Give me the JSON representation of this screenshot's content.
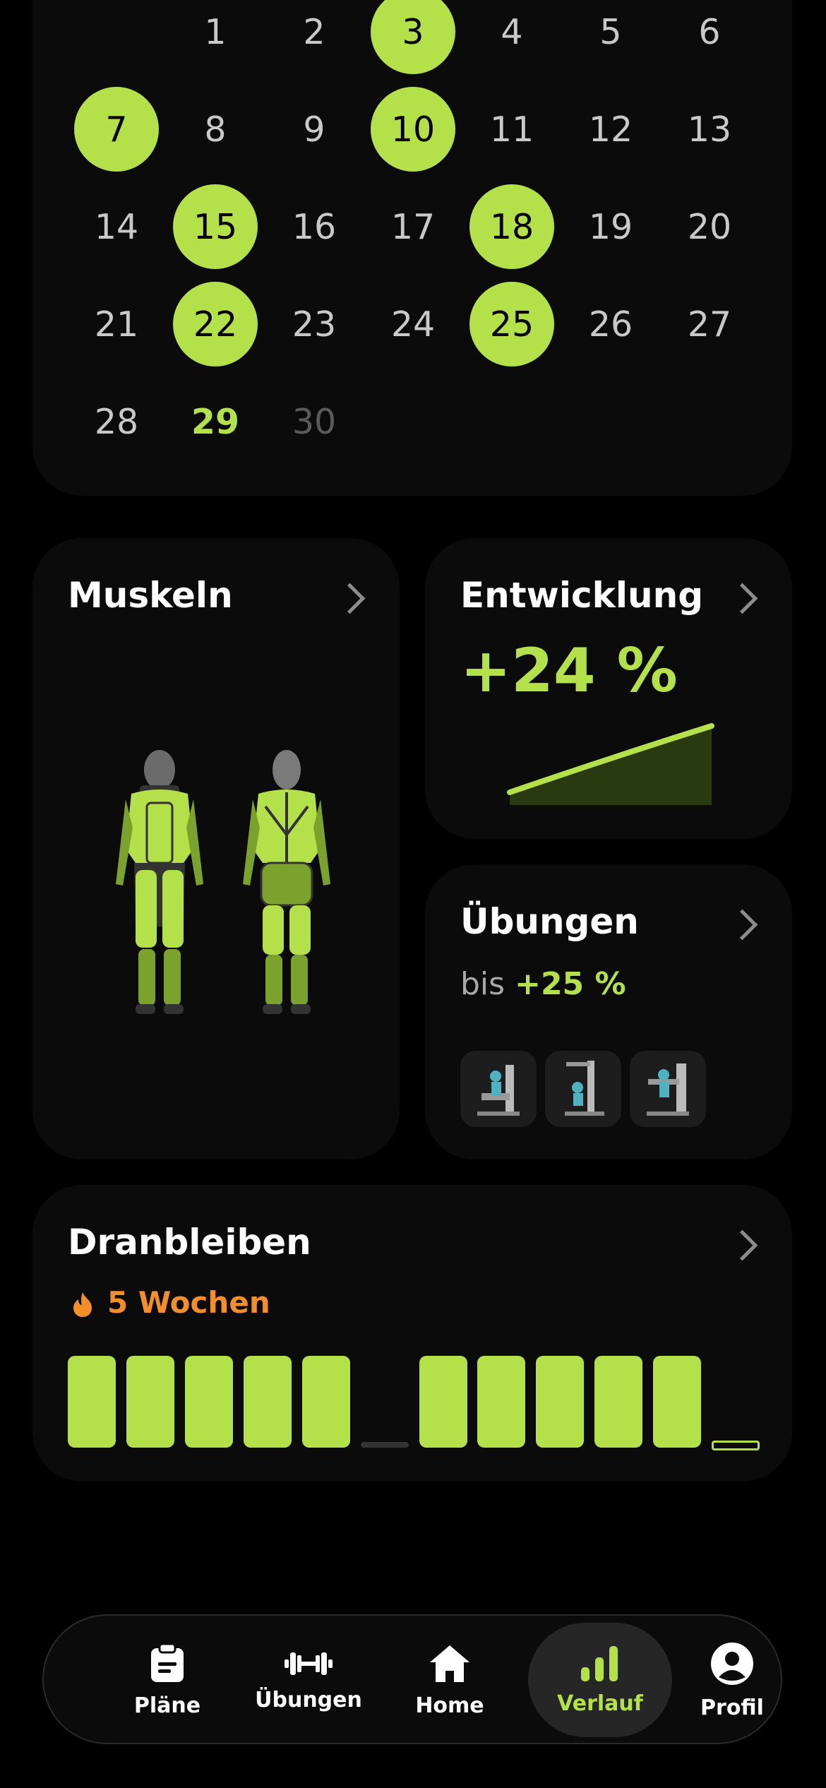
{
  "calendar": {
    "days": [
      {
        "d": "1",
        "state": "normal"
      },
      {
        "d": "2",
        "state": "normal"
      },
      {
        "d": "3",
        "state": "done"
      },
      {
        "d": "4",
        "state": "normal"
      },
      {
        "d": "5",
        "state": "normal"
      },
      {
        "d": "6",
        "state": "normal"
      },
      {
        "d": "7",
        "state": "done"
      },
      {
        "d": "8",
        "state": "normal"
      },
      {
        "d": "9",
        "state": "normal"
      },
      {
        "d": "10",
        "state": "done"
      },
      {
        "d": "11",
        "state": "normal"
      },
      {
        "d": "12",
        "state": "normal"
      },
      {
        "d": "13",
        "state": "normal"
      },
      {
        "d": "14",
        "state": "normal"
      },
      {
        "d": "15",
        "state": "done"
      },
      {
        "d": "16",
        "state": "normal"
      },
      {
        "d": "17",
        "state": "normal"
      },
      {
        "d": "18",
        "state": "done"
      },
      {
        "d": "19",
        "state": "normal"
      },
      {
        "d": "20",
        "state": "normal"
      },
      {
        "d": "21",
        "state": "normal"
      },
      {
        "d": "22",
        "state": "done"
      },
      {
        "d": "23",
        "state": "normal"
      },
      {
        "d": "24",
        "state": "normal"
      },
      {
        "d": "25",
        "state": "done"
      },
      {
        "d": "26",
        "state": "normal"
      },
      {
        "d": "27",
        "state": "normal"
      },
      {
        "d": "28",
        "state": "normal"
      },
      {
        "d": "29",
        "state": "today"
      },
      {
        "d": "30",
        "state": "future"
      }
    ]
  },
  "muscles": {
    "title": "Muskeln"
  },
  "progress": {
    "title": "Entwicklung",
    "value": "+24 %"
  },
  "exercises": {
    "title": "Übungen",
    "prefix": "bis",
    "value": "+25 %",
    "thumbs": [
      "chest-press-machine-icon",
      "lat-pulldown-machine-icon",
      "shoulder-press-machine-icon"
    ]
  },
  "streak": {
    "title": "Dranbleiben",
    "weeks": "5 Wochen",
    "bars": [
      1,
      1,
      1,
      1,
      1,
      0,
      1,
      1,
      1,
      1,
      1,
      "current"
    ]
  },
  "nav": {
    "items": [
      {
        "label": "Pläne",
        "icon": "clipboard-icon"
      },
      {
        "label": "Übungen",
        "icon": "dumbbell-icon"
      },
      {
        "label": "Home",
        "icon": "home-icon"
      },
      {
        "label": "Verlauf",
        "icon": "bar-chart-icon",
        "active": true
      },
      {
        "label": "Profil",
        "icon": "profile-icon"
      }
    ]
  },
  "colors": {
    "accent": "#b4e04a",
    "streak": "#f28f2a",
    "card": "#0b0b0b"
  }
}
